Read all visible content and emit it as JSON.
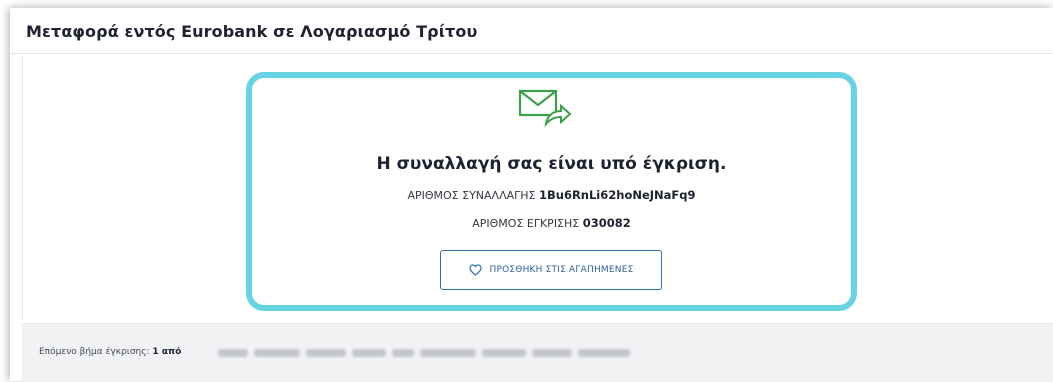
{
  "page": {
    "title": "Μεταφορά εντός Eurobank σε Λογαριασμό Τρίτου"
  },
  "confirmation": {
    "icon": "mail-forward-icon",
    "heading": "Η συναλλαγή σας είναι υπό έγκριση.",
    "transaction_label": "ΑΡΙΘΜΟΣ ΣΥΝΑΛΛΑΓΗΣ",
    "transaction_value": "1Bu6RnLi62hoNeJNaFq9",
    "approval_label": "ΑΡΙΘΜΟΣ ΕΓΚΡΙΣΗΣ",
    "approval_value": "030082",
    "favorites_button": "ΠΡΟΣΘΗΚΗ ΣΤΙΣ ΑΓΑΠΗΜΕΝΕΣ",
    "favorites_icon": "heart-icon"
  },
  "footer": {
    "next_step_label": "Επόμενο βήμα έγκρισης:",
    "next_step_value": "1 από"
  },
  "colors": {
    "highlight": "#67d3e3",
    "icon_green": "#3aa047",
    "button_blue": "#2f6fb0"
  }
}
